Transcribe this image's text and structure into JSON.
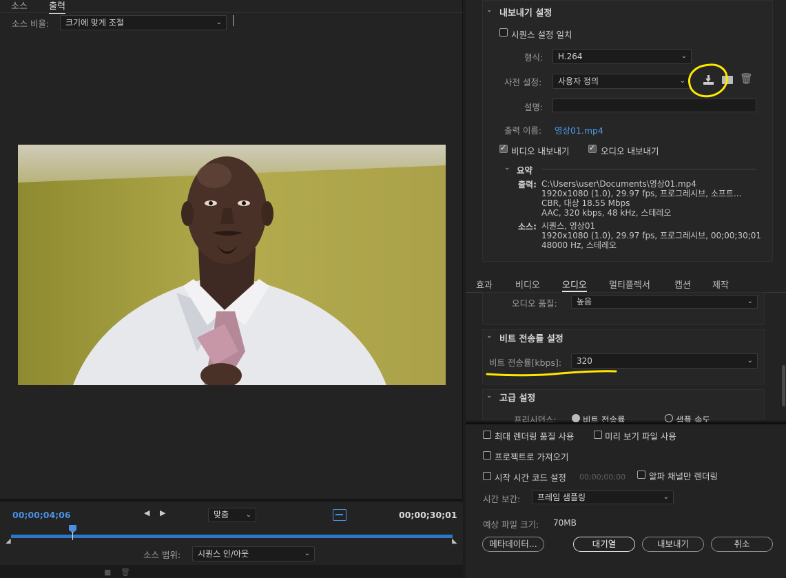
{
  "left_panel": {
    "tabs": [
      "소스",
      "출력"
    ],
    "active_tab": "출력",
    "source_scale_label": "소스 비율:",
    "source_scale_value": "크기에 맞게 조절"
  },
  "timeline": {
    "current_time": "00;00;04;06",
    "zoom_value": "맞춤",
    "end_time": "00;00;30;01",
    "source_range_label": "소스 범위:",
    "source_range_value": "시퀀스 인/아웃",
    "playhead_fraction": 0.14
  },
  "export_settings": {
    "title": "내보내기 설정",
    "match_sequence_label": "시퀀스 설정 일치",
    "format_label": "형식:",
    "format_value": "H.264",
    "preset_label": "사전 설정:",
    "preset_value": "사용자 정의",
    "comment_label": "설명:",
    "output_name_label": "출력 이름:",
    "output_name_value": "영상01.mp4",
    "export_video_label": "비디오 내보내기",
    "export_audio_label": "오디오 내보내기",
    "summary_title": "요약",
    "summary_output_key": "출력:",
    "summary_output_lines": "C:\\Users\\user\\Documents\\영상01.mp4\n1920x1080 (1.0), 29.97 fps, 프로그레시브, 소프트...\nCBR, 대상 18.55 Mbps\nAAC, 320 kbps, 48 kHz, 스테레오",
    "summary_source_key": "소스:",
    "summary_source_lines": "시퀀스, 영상01\n1920x1080 (1.0), 29.97 fps, 프로그레시브, 00;00;30;01\n48000 Hz, 스테레오"
  },
  "sub_tabs": [
    "효과",
    "비디오",
    "오디오",
    "멀티플렉서",
    "캡션",
    "제작"
  ],
  "active_sub_tab": "오디오",
  "audio": {
    "quality_label": "오디오 품질:",
    "quality_value": "높음",
    "bitrate_title": "비트 전송률 설정",
    "bitrate_label": "비트 전송률[kbps]:",
    "bitrate_value": "320",
    "advanced_title": "고급 설정",
    "precedence_label": "프리시던스:",
    "precedence_opt1": "비트 전송률",
    "precedence_opt2": "샘플 속도"
  },
  "bottom": {
    "max_render_label": "최대 렌더링 품질 사용",
    "preview_files_label": "미리 보기 파일 사용",
    "import_project_label": "프로젝트로 가져오기",
    "start_timecode_label": "시작 시간 코드 설정",
    "start_timecode_value": "00;00;00;00",
    "alpha_only_label": "알파 채널만 렌더링",
    "time_interp_label": "시간 보간:",
    "time_interp_value": "프레임 샘플링",
    "est_size_label": "예상 파일 크기:",
    "est_size_value": "70MB",
    "metadata_button": "메타데이터...",
    "queue_button": "대기열",
    "export_button": "내보내기",
    "cancel_button": "취소"
  },
  "colors": {
    "accent_blue": "#4a90e2",
    "annotation_yellow": "#ffe800",
    "panel_bg": "#232323"
  }
}
